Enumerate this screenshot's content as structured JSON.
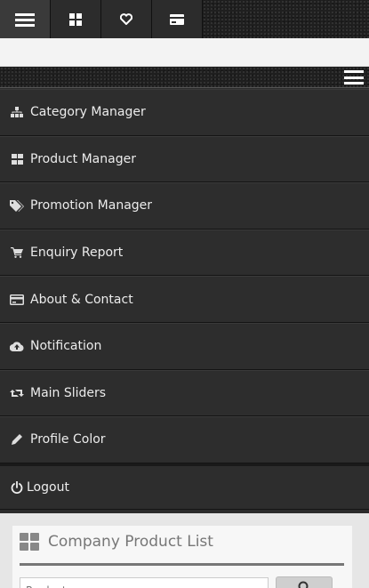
{
  "toolbar": {
    "buttons": [
      {
        "icon": "hamburger-icon",
        "active": true
      },
      {
        "icon": "grid-icon",
        "active": false
      },
      {
        "icon": "heart-icon",
        "active": false
      },
      {
        "icon": "card-icon",
        "active": false
      }
    ]
  },
  "sidemenu": {
    "items": [
      {
        "label": "Category Manager",
        "icon": "sitemap-icon"
      },
      {
        "label": "Product Manager",
        "icon": "grid-icon"
      },
      {
        "label": "Promotion Manager",
        "icon": "tags-icon"
      },
      {
        "label": "Enquiry Report",
        "icon": "cart-icon"
      },
      {
        "label": "About & Contact",
        "icon": "card-icon"
      },
      {
        "label": "Notification",
        "icon": "cloud-upload-icon"
      },
      {
        "label": "Main Sliders",
        "icon": "retweet-icon"
      },
      {
        "label": "Profile Color",
        "icon": "pencil-icon"
      }
    ],
    "logout_label": "Logout"
  },
  "content": {
    "panel_title": "Company Product List",
    "search_placeholder": "Product ..."
  },
  "colors": {
    "menu_bg": "#2d2d2d",
    "menu_text": "#ececec",
    "content_bg": "#e6e6e6",
    "panel_title": "#777777"
  }
}
